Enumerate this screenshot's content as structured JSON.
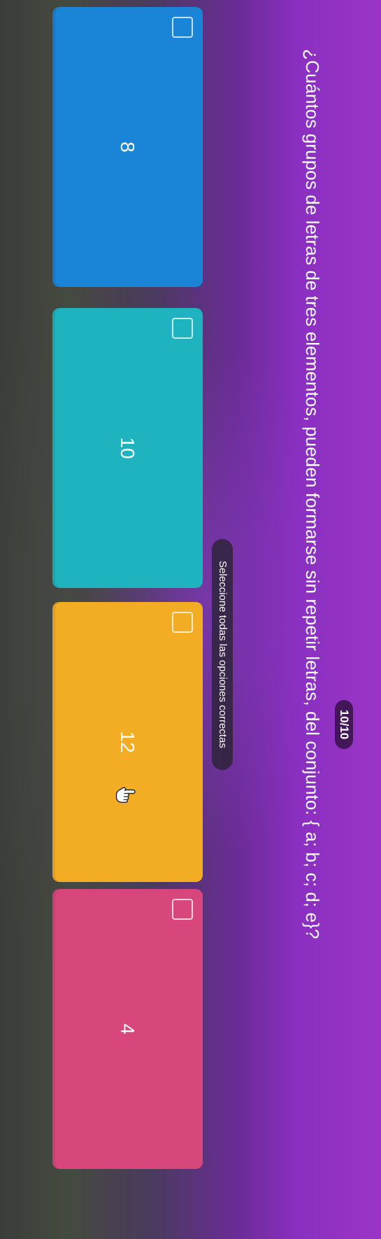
{
  "progress": {
    "counter_text": "10/10"
  },
  "question": {
    "text": "¿Cuántos grupos de letras de tres elementos, pueden formarse sin repetir letras, del conjunto: { a; b; c; d; e}?"
  },
  "instruction": {
    "text": "Seleccione todas las opciones correctas"
  },
  "options": [
    {
      "label": "8",
      "color": "#1a84d6",
      "checked": false
    },
    {
      "label": "10",
      "color": "#1fb3c0",
      "checked": false
    },
    {
      "label": "12",
      "color": "#f2ad25",
      "checked": false
    },
    {
      "label": "4",
      "color": "#d8477c",
      "checked": false
    }
  ],
  "cursor": {
    "icon": "pointer-hand-icon"
  }
}
